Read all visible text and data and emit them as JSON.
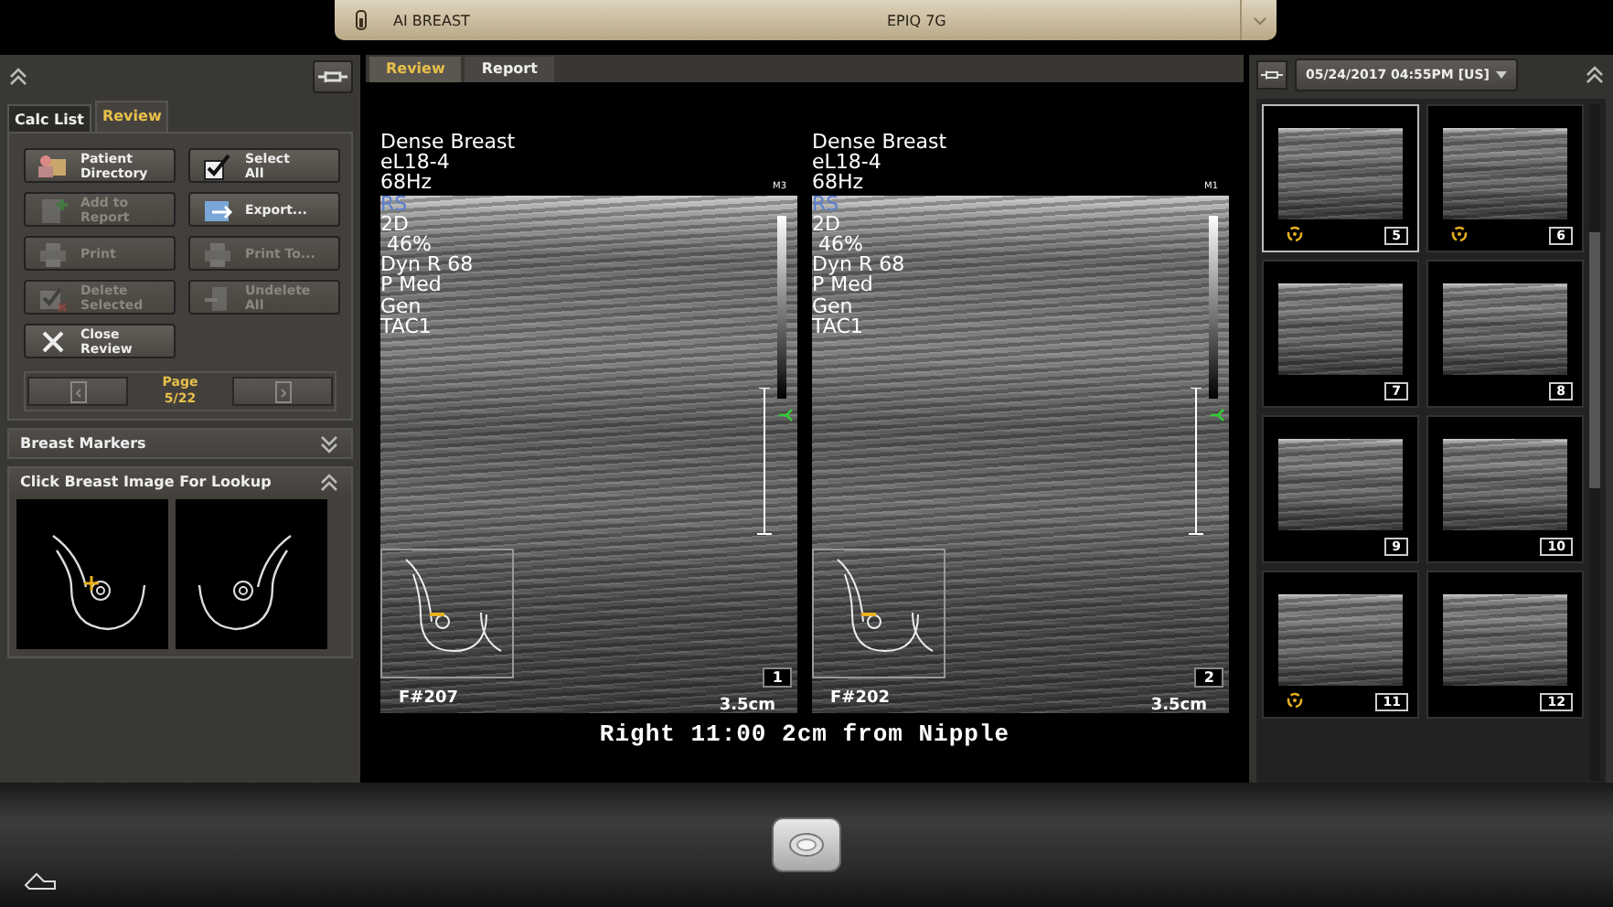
{
  "top_bar": {
    "preset": "AI BREAST",
    "system": "EPIQ 7G"
  },
  "left_panel": {
    "tabs": [
      {
        "label": "Calc List",
        "selected": false
      },
      {
        "label": "Review",
        "selected": true
      }
    ],
    "buttons": [
      {
        "label": "Patient\nDirectory",
        "kind": "directory",
        "disabled": false
      },
      {
        "label": "Select\nAll",
        "kind": "select",
        "disabled": false
      },
      {
        "label": "Add to\nReport",
        "kind": "report",
        "disabled": true
      },
      {
        "label": "Export...",
        "kind": "export",
        "disabled": false
      },
      {
        "label": "Print",
        "kind": "print",
        "disabled": true
      },
      {
        "label": "Print To...",
        "kind": "print",
        "disabled": true
      },
      {
        "label": "Delete\nSelected",
        "kind": "delete",
        "disabled": true
      },
      {
        "label": "Undelete\nAll",
        "kind": "undelete",
        "disabled": true
      },
      {
        "label": "Close\nReview",
        "kind": "close",
        "disabled": false
      }
    ],
    "page": {
      "label": "Page",
      "value": "5/22"
    },
    "sections": [
      {
        "title": "Breast Markers",
        "expanded": false
      },
      {
        "title": "Click Breast Image For Lookup",
        "expanded": true
      }
    ]
  },
  "viewer": {
    "tabs": [
      {
        "label": "Review",
        "selected": true
      },
      {
        "label": "Report",
        "selected": false
      }
    ],
    "images": [
      {
        "annotations": [
          "Dense Breast",
          "eL18-4",
          "68Hz",
          "RS",
          "2D",
          " 46%",
          "Dyn R 68",
          "P Med",
          "Gen",
          "TAC1"
        ],
        "marker": "M3",
        "frame": "F#207",
        "depth": "3.5cm",
        "number": "1"
      },
      {
        "annotations": [
          "Dense Breast",
          "eL18-4",
          "68Hz",
          "RS",
          "2D",
          " 46%",
          "Dyn R 68",
          "P Med",
          "Gen",
          "TAC1"
        ],
        "marker": "M1",
        "frame": "F#202",
        "depth": "3.5cm",
        "number": "2"
      }
    ],
    "caption": "Right 11:00 2cm from Nipple"
  },
  "right_panel": {
    "exam": "05/24/2017 04:55PM [US]",
    "thumbnails": [
      {
        "number": "5",
        "selected": true,
        "flagged": true
      },
      {
        "number": "6",
        "selected": false,
        "flagged": true
      },
      {
        "number": "7",
        "selected": false,
        "flagged": false
      },
      {
        "number": "8",
        "selected": false,
        "flagged": false
      },
      {
        "number": "9",
        "selected": false,
        "flagged": false
      },
      {
        "number": "10",
        "selected": false,
        "flagged": false
      },
      {
        "number": "11",
        "selected": false,
        "flagged": true
      },
      {
        "number": "12",
        "selected": false,
        "flagged": false
      }
    ]
  }
}
